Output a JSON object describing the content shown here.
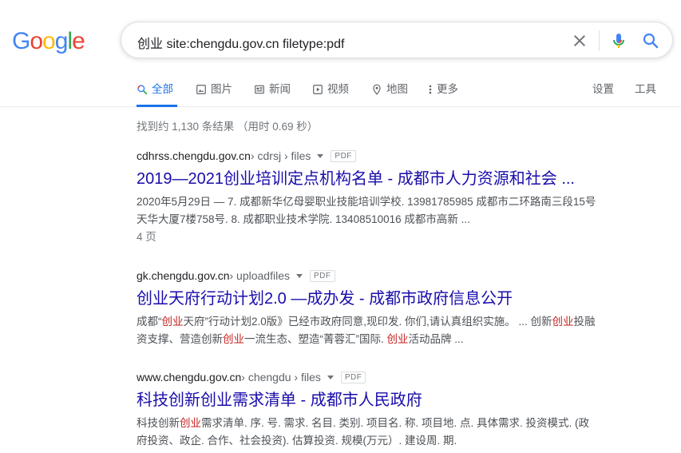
{
  "logo": {
    "text": "Google",
    "colors": [
      "#4285F4",
      "#EA4335",
      "#FBBC05",
      "#4285F4",
      "#34A853",
      "#EA4335"
    ]
  },
  "search": {
    "query": "创业 site:chengdu.gov.cn filetype:pdf"
  },
  "tabs": [
    {
      "label": "全部",
      "icon": "search-icon"
    },
    {
      "label": "图片",
      "icon": "image-icon"
    },
    {
      "label": "新闻",
      "icon": "news-icon"
    },
    {
      "label": "视频",
      "icon": "video-icon"
    },
    {
      "label": "地图",
      "icon": "map-pin-icon"
    },
    {
      "label": "更多",
      "icon": "more-vert-icon"
    }
  ],
  "tools": {
    "settings": "设置",
    "tools": "工具"
  },
  "stats": "找到约 1,130 条结果 （用时 0.69 秒）",
  "file_badge": "PDF",
  "results": [
    {
      "domain": "cdhrss.chengdu.gov.cn",
      "path": " › cdrsj › files",
      "title": "2019—2021创业培训定点机构名单 - 成都市人力资源和社会 ...",
      "snippet_line1": "2020年5月29日 — 7. 成都新华亿母婴职业技能培训学校. 13981785985 成都市二环路南三段15号",
      "snippet_line2": "天华大厦7楼758号. 8. 成都职业技术学院. 13408510016 成都市高新 ...",
      "pages": "4 页"
    },
    {
      "domain": "gk.chengdu.gov.cn",
      "path": " › uploadfiles",
      "title": "创业天府行动计划2.0 —成办发 - 成都市政府信息公开",
      "snippet_l1_a": "成都“",
      "snippet_l1_b": "创业",
      "snippet_l1_c": "天府”行动计划2.0版》已经市政府同意,现印发. 你们,请认真组织实施。 ... 创新",
      "snippet_l1_d": "创业",
      "snippet_l1_e": "投融",
      "snippet_l2_a": "资支撑、营造创新",
      "snippet_l2_b": "创业",
      "snippet_l2_c": "一流生态、塑造“菁蓉汇”国际. ",
      "snippet_l2_d": "创业",
      "snippet_l2_e": "活动品牌 ..."
    },
    {
      "domain": "www.chengdu.gov.cn",
      "path": " › chengdu › files",
      "title": "科技创新创业需求清单 - 成都市人民政府",
      "snippet_l1_a": "科技创新",
      "snippet_l1_b": "创业",
      "snippet_l1_c": "需求清单. 序. 号. 需求. 名目. 类别. 项目名. 称. 项目地. 点. 具体需求. 投资模式. (政",
      "snippet_l2": "府投资、政企. 合作、社会投资). 估算投资. 规模(万元）. 建设周. 期."
    }
  ]
}
